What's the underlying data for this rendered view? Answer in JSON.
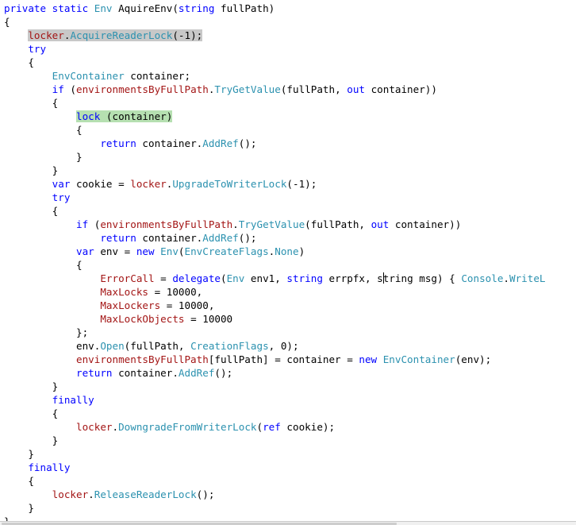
{
  "editor": {
    "lines": [
      "private static Env AquireEnv(string fullPath)",
      "{",
      "    locker.AcquireReaderLock(-1);",
      "    try",
      "    {",
      "        EnvContainer container;",
      "        if (environmentsByFullPath.TryGetValue(fullPath, out container))",
      "        {",
      "            lock (container)",
      "            {",
      "                return container.AddRef();",
      "            }",
      "        }",
      "        var cookie = locker.UpgradeToWriterLock(-1);",
      "        try",
      "        {",
      "            if (environmentsByFullPath.TryGetValue(fullPath, out container))",
      "                return container.AddRef();",
      "            var env = new Env(EnvCreateFlags.None)",
      "            {",
      "                ErrorCall = delegate(Env env1, string errpfx, string msg) { Console.WriteL",
      "                MaxLocks = 10000,",
      "                MaxLockers = 10000,",
      "                MaxLockObjects = 10000",
      "            };",
      "            env.Open(fullPath, CreationFlags, 0);",
      "            environmentsByFullPath[fullPath] = container = new EnvContainer(env);",
      "            return container.AddRef();",
      "        }",
      "        finally",
      "        {",
      "            locker.DowngradeFromWriterLock(ref cookie);",
      "        }",
      "    }",
      "    finally",
      "    {",
      "        locker.ReleaseReaderLock();",
      "    }",
      "}"
    ],
    "keywords": [
      "private",
      "static",
      "string",
      "try",
      "if",
      "out",
      "lock",
      "return",
      "var",
      "new",
      "delegate",
      "finally",
      "ref"
    ],
    "types": [
      "Env",
      "EnvContainer",
      "EnvCreateFlags",
      "Console",
      "CreationFlags"
    ],
    "highlights": [
      {
        "line": 2,
        "text": "locker.AcquireReaderLock(-1);",
        "style": "grey"
      },
      {
        "line": 8,
        "text": "lock (container)",
        "style": "green"
      }
    ],
    "caret": {
      "line": 20,
      "column": 63
    },
    "colors": {
      "keyword": "#0000ff",
      "type": "#2b91af",
      "plain": "#000000",
      "highlight_grey": "#c8c8c8",
      "highlight_green": "#b6e0b1"
    }
  }
}
